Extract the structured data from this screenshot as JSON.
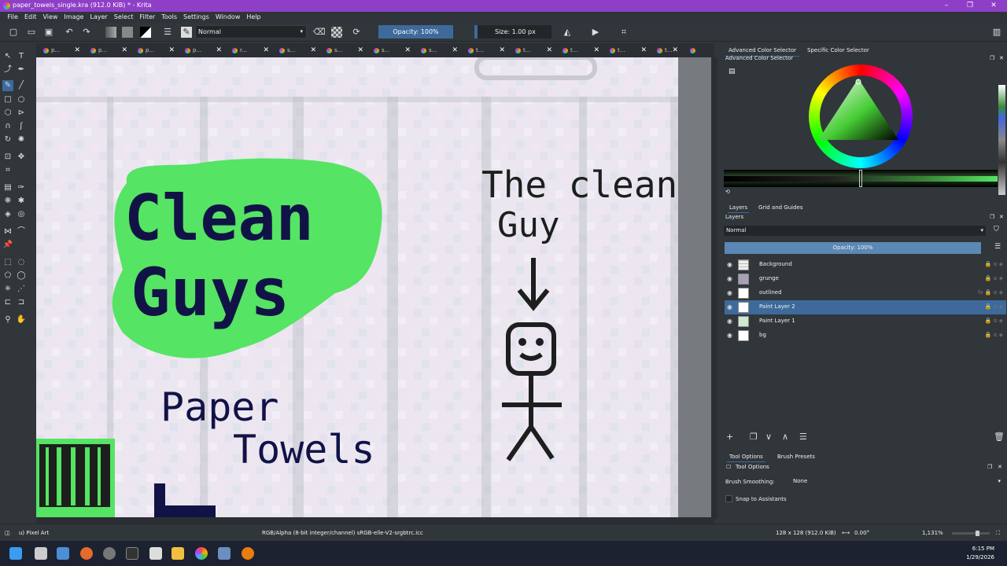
{
  "window": {
    "title": "paper_towels_single.kra (912.0 KiB)  * - Krita",
    "controls": [
      "–",
      "❐",
      "✕"
    ]
  },
  "menu": [
    "File",
    "Edit",
    "View",
    "Image",
    "Layer",
    "Select",
    "Filter",
    "Tools",
    "Settings",
    "Window",
    "Help"
  ],
  "toolbar": {
    "blend_mode": "Normal",
    "opacity": "Opacity: 100%",
    "size": "Size: 1.00 px"
  },
  "tabs": [
    "p...",
    "p...",
    "p...",
    "p...",
    "r...",
    "s...",
    "s...",
    "s...",
    "s...",
    "t...",
    "t...",
    "t...",
    "t...",
    "t...",
    ""
  ],
  "canvas": {
    "artwork_text": {
      "logo_line1": "Clean",
      "logo_line2": "Guys",
      "product_line1": "Paper",
      "product_line2": "Towels",
      "right_line1": "The clean",
      "right_line2": "Guy"
    },
    "colors": {
      "background": "#ece6f0",
      "splash": "#55e463",
      "ink_navy": "#111347",
      "ink_dark": "#1c1f1d"
    }
  },
  "dock": {
    "color_tabs": [
      "Advanced Color Selector",
      "Specific Color Selector"
    ],
    "color_panel_title": "Advanced Color Selector",
    "layer_tabs": [
      "Layers",
      "Grid and Guides"
    ],
    "layers_title": "Layers",
    "blend_mode": "Normal",
    "opacity": "Opacity:  100%",
    "layers": [
      {
        "name": "Background",
        "selected": false
      },
      {
        "name": "grunge",
        "selected": false
      },
      {
        "name": "outlined",
        "selected": false
      },
      {
        "name": "Paint Layer 2",
        "selected": true
      },
      {
        "name": "Paint Layer 1",
        "selected": false
      },
      {
        "name": "bg",
        "selected": false
      }
    ],
    "tool_tabs": [
      "Tool Options",
      "Brush Presets"
    ],
    "tool_options_title": "Tool Options",
    "brush_smoothing_label": "Brush Smoothing:",
    "brush_smoothing_value": "None",
    "snap_label": "Snap to Assistants"
  },
  "status": {
    "brush": "u) Pixel Art",
    "color_space": "RGB/Alpha (8-bit integer/channel)  sRGB-elle-V2-srgbtrc.icc",
    "image_size": "128 x 128 (912.0 KiB)",
    "rotation": "0.00°",
    "zoom": "1,131%"
  },
  "taskbar": {
    "time": "6:15 PM",
    "date": "1/29/2026"
  }
}
